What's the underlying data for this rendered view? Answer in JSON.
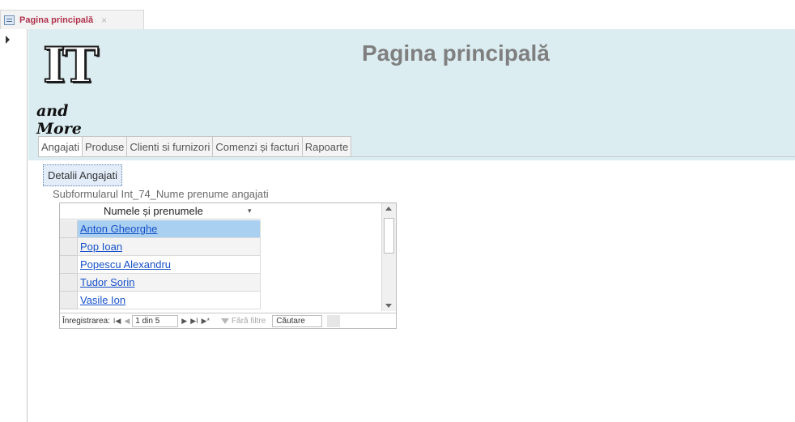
{
  "doc_tab": {
    "label": "Pagina principală",
    "close": "×"
  },
  "header": {
    "logo_big": "IT",
    "logo_small": "and More",
    "title": "Pagina principală"
  },
  "tabs": [
    {
      "label": "Angajati",
      "active": true
    },
    {
      "label": "Produse",
      "active": false
    },
    {
      "label": "Clienti si furnizori",
      "active": false
    },
    {
      "label": "Comenzi și facturi",
      "active": false
    },
    {
      "label": "Rapoarte",
      "active": false
    }
  ],
  "details_button": "Detalii Angajati",
  "subform": {
    "label": "Subformularul Int_74_Nume prenume angajati",
    "column_header": "Numele și prenumele",
    "rows": [
      "Anton Gheorghe",
      "Pop Ioan",
      "Popescu Alexandru",
      "Tudor Sorin",
      "Vasile Ion"
    ],
    "selected_row": 0
  },
  "navigation": {
    "record_label": "Înregistrarea:",
    "first": "I◀",
    "prev": "◀",
    "position": "1 din 5",
    "next": "▶",
    "last": "▶I",
    "new": "▶*",
    "filter_label": "Fără filtre",
    "search_placeholder": "Căutare"
  }
}
